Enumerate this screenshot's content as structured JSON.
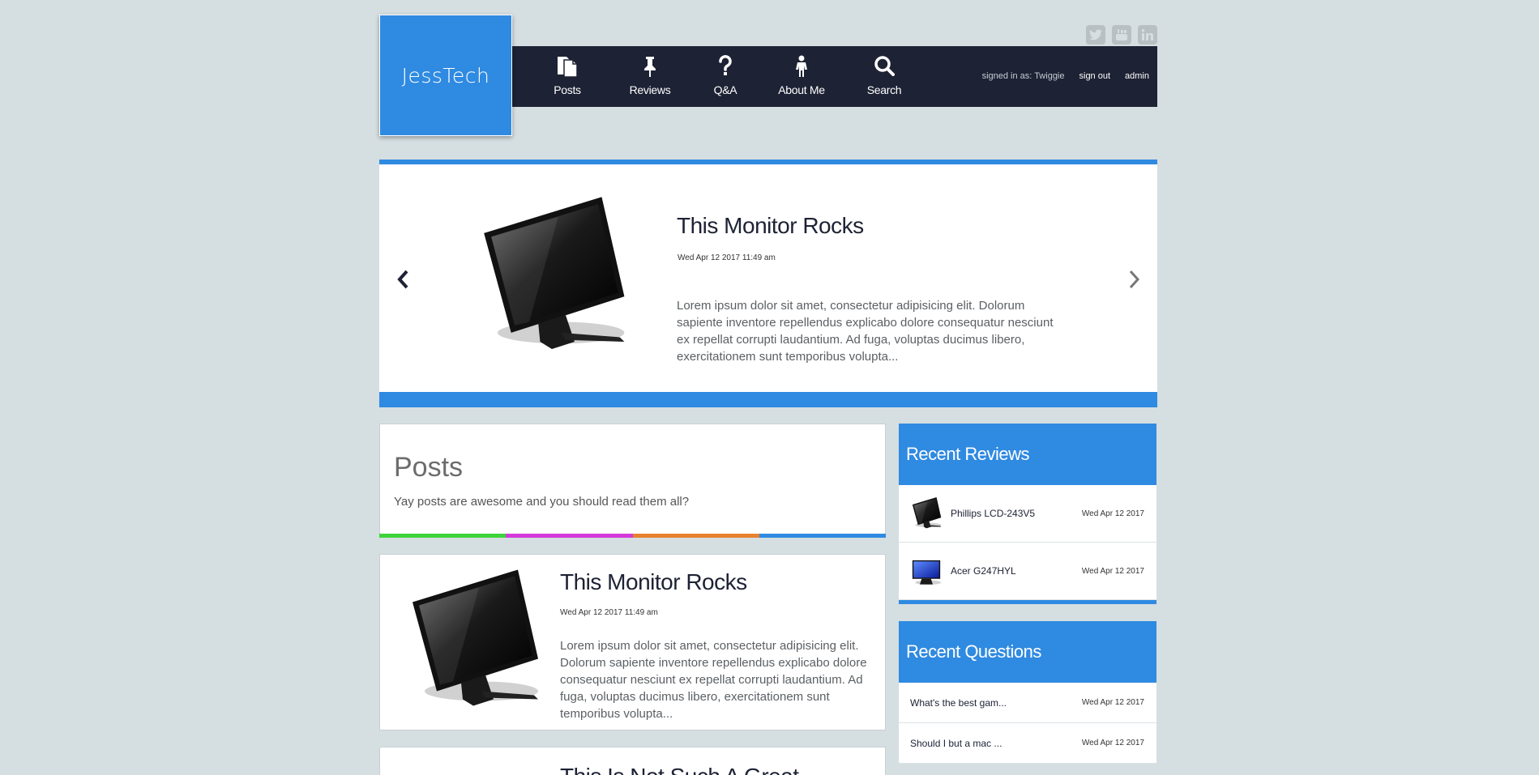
{
  "brand": {
    "logo_text": "JessTech",
    "accent": "#2f8ae1",
    "nav_bg": "#1d2234",
    "page_bg": "#d5dee1"
  },
  "social": [
    "twitter-icon",
    "youtube-icon",
    "linkedin-icon"
  ],
  "nav": {
    "items": [
      {
        "label": "Posts",
        "icon": "file-icon"
      },
      {
        "label": "Reviews",
        "icon": "pin-icon"
      },
      {
        "label": "Q&A",
        "icon": "question-icon"
      },
      {
        "label": "About Me",
        "icon": "person-icon"
      },
      {
        "label": "Search",
        "icon": "search-icon"
      }
    ],
    "signed_in": "signed in as: Twiggie",
    "sign_out": "sign out",
    "admin": "admin"
  },
  "carousel": {
    "title": "This Monitor Rocks",
    "date": "Wed Apr 12 2017 11:49 am",
    "excerpt": "Lorem ipsum dolor sit amet, consectetur adipisicing elit. Dolorum sapiente inventore repellendus explicabo dolore consequatur nesciunt ex repellat corrupti laudantium. Ad fuga, voluptas ducimus libero, exercitationem sunt temporibus volupta..."
  },
  "posts": {
    "heading": "Posts",
    "subheading": "Yay posts are awesome and you should read them all?",
    "bar_colors": [
      "#3ed33a",
      "#d43ad9",
      "#e88130",
      "#2f8ae1"
    ],
    "items": [
      {
        "title": "This Monitor Rocks",
        "date": "Wed Apr 12 2017 11:49 am",
        "excerpt": "Lorem ipsum dolor sit amet, consectetur adipisicing elit. Dolorum sapiente inventore repellendus explicabo dolore consequatur nesciunt ex repellat corrupti laudantium. Ad fuga, voluptas ducimus libero, exercitationem sunt temporibus volupta..."
      },
      {
        "title": "This Is Not Such A Great",
        "date": "",
        "excerpt": ""
      }
    ]
  },
  "recent_reviews": {
    "heading": "Recent Reviews",
    "items": [
      {
        "name": "Phillips LCD-243V5",
        "date": "Wed Apr 12 2017"
      },
      {
        "name": "Acer G247HYL",
        "date": "Wed Apr 12 2017"
      }
    ]
  },
  "recent_questions": {
    "heading": "Recent Questions",
    "items": [
      {
        "name": "What's the best gam...",
        "date": "Wed Apr 12 2017"
      },
      {
        "name": "Should I but a mac ...",
        "date": "Wed Apr 12 2017"
      }
    ]
  }
}
